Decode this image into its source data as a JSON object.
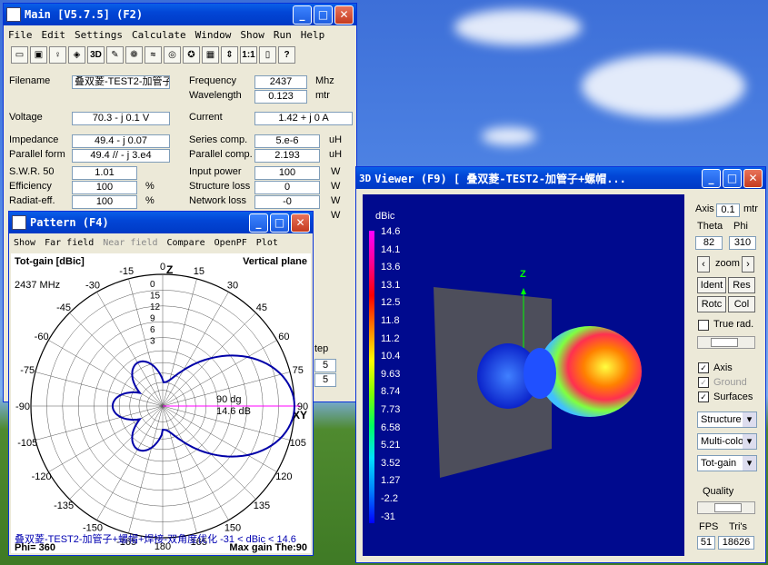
{
  "main": {
    "title": "Main [V5.7.5]    (F2)",
    "menu": [
      "File",
      "Edit",
      "Settings",
      "Calculate",
      "Window",
      "Show",
      "Run",
      "Help"
    ],
    "toolbar": [
      "3D",
      "1:1"
    ],
    "filename_label": "Filename",
    "filename": "叠双菱-TEST2-加管子",
    "frequency_label": "Frequency",
    "frequency": "2437",
    "frequency_unit": "Mhz",
    "wavelength_label": "Wavelength",
    "wavelength": "0.123",
    "wavelength_unit": "mtr",
    "voltage_label": "Voltage",
    "voltage": "70.3 - j 0.1 V",
    "current_label": "Current",
    "current": "1.42 + j 0 A",
    "impedance_label": "Impedance",
    "impedance": "49.4 - j 0.07",
    "series_label": "Series comp.",
    "series": "5.e-6",
    "series_unit": "uH",
    "parallel_form_label": "Parallel form",
    "parallel_form": "49.4 // - j 3.e4",
    "parallel_comp_label": "Parallel comp.",
    "parallel_comp": "2.193",
    "parallel_unit": "uH",
    "swr_label": "S.W.R. 50",
    "swr": "1.01",
    "input_power_label": "Input power",
    "input_power": "100",
    "efficiency_label": "Efficiency",
    "efficiency": "100",
    "structure_loss_label": "Structure loss",
    "structure_loss": "0",
    "radiat_label": "Radiat-eff.",
    "radiat": "100",
    "network_loss_label": "Network loss",
    "network_loss": "-0",
    "percent": "%",
    "watt": "W",
    "step_label": "tep",
    "step1": "5",
    "step2": "5"
  },
  "pattern": {
    "title": "Pattern    (F4)",
    "menu": [
      "Show",
      "Far field",
      "Near field",
      "Compare",
      "OpenPF",
      "Plot"
    ],
    "gain_label": "Tot-gain [dBic]",
    "plane": "Vertical plane",
    "freq": "2437 MHz",
    "z_label": "Z",
    "xy_label": "XY",
    "marker_deg": "90 dg",
    "marker_db": "14.6 dB",
    "ring_labels": [
      "0",
      "15",
      "12",
      "9",
      "6",
      "3"
    ],
    "angle_labels": [
      "0",
      "15",
      "30",
      "45",
      "60",
      "75",
      "90",
      "105",
      "120",
      "135",
      "150",
      "165",
      "180",
      "-165",
      "-150",
      "-135",
      "-120",
      "-105",
      "-90",
      "-75",
      "-60",
      "-45",
      "-30",
      "-15"
    ],
    "footer_name": "叠双菱-TEST2-加管子+螺帽+焊接-双角度优化",
    "footer_range": "-31 < dBic < 14.6",
    "phi": "Phi= 360",
    "max_gain": "Max gain The:90"
  },
  "viewer": {
    "title": "Viewer (F9)    [  叠双菱-TEST2-加管子+螺帽...",
    "title_prefix": "3D",
    "scale_label": "dBic",
    "scale": [
      "14.6",
      "14.1",
      "13.6",
      "13.1",
      "12.5",
      "11.8",
      "11.2",
      "10.4",
      "9.63",
      "8.74",
      "7.73",
      "6.58",
      "5.21",
      "3.52",
      "1.27",
      "-2.2",
      "-31"
    ],
    "z_axis": "Z",
    "axis_label": "Axis",
    "axis_val": "0.1",
    "axis_unit": "mtr",
    "theta_label": "Theta",
    "phi_label": "Phi",
    "theta": "82",
    "phi": "310",
    "zoom": "zoom",
    "ident": "Ident",
    "res": "Res",
    "rotc": "Rotc",
    "col": "Col",
    "true_rad": "True rad.",
    "chk_axis": "Axis",
    "chk_ground": "Ground",
    "chk_surfaces": "Surfaces",
    "sel_structure": "Structure",
    "sel_multi": "Multi-colo",
    "sel_gain": "Tot-gain",
    "quality": "Quality",
    "fps_label": "FPS",
    "tris_label": "Tri's",
    "fps": "51",
    "tris": "18626"
  },
  "colors": {
    "title": "#0046d5",
    "pattern_line": "#0000a8",
    "viewport": "#000a8e"
  }
}
